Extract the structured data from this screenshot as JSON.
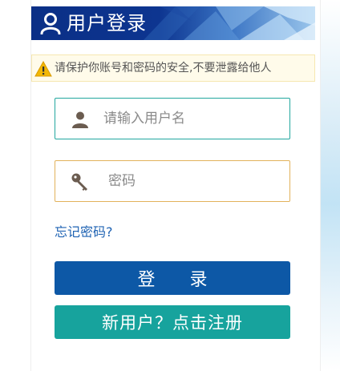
{
  "header": {
    "title": "用户登录"
  },
  "notice": {
    "text": "请保护你账号和密码的安全,不要泄露给他人"
  },
  "form": {
    "username_placeholder": "请输入用户名",
    "username_value": "",
    "password_placeholder": "密码",
    "password_value": ""
  },
  "links": {
    "forgot_password": "忘记密码?"
  },
  "buttons": {
    "login": "登 录",
    "register": "新用户？点击注册"
  },
  "colors": {
    "banner": "#0a2f86",
    "username_border": "#22a79f",
    "password_border": "#e2b25b",
    "link": "#1f63b3",
    "login_button": "#0d58a6",
    "register_button": "#17a39d"
  },
  "icons": {
    "banner": "user-outline-icon",
    "notice": "warning-triangle-icon",
    "username": "person-icon",
    "password": "key-icon"
  }
}
